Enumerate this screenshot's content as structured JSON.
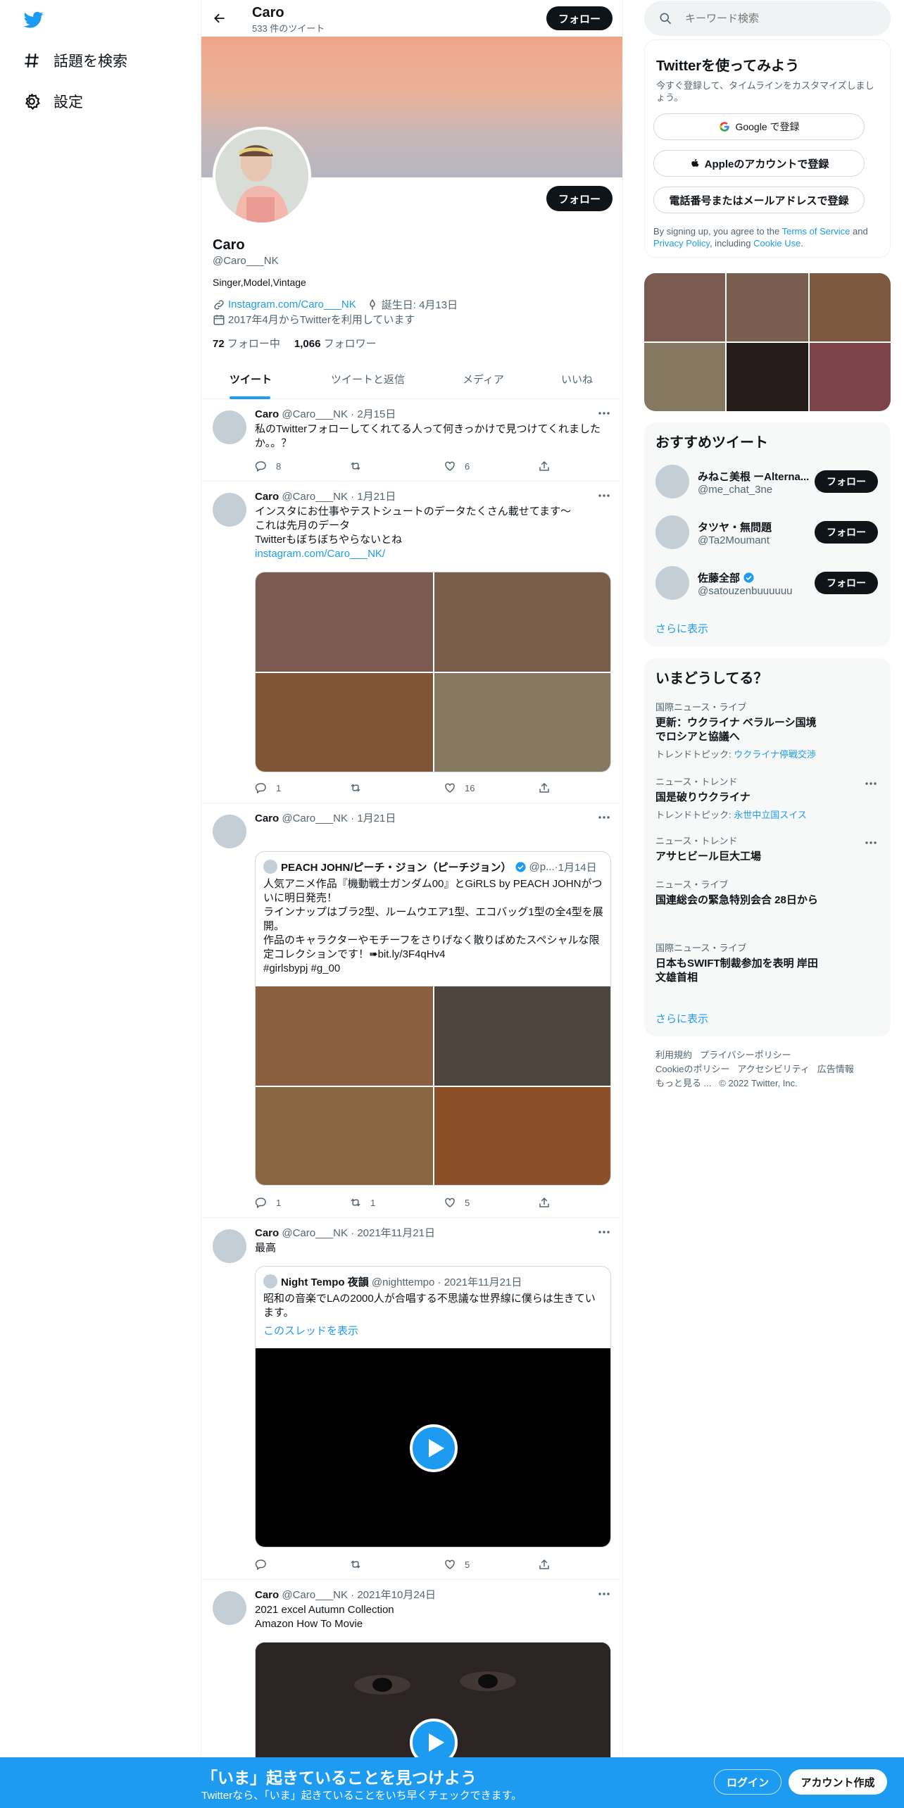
{
  "colors": {
    "accent": "#1d9bf0",
    "dark": "#0f1419",
    "muted": "#536471",
    "border": "#eff3f4",
    "verified": "#1d9bf0",
    "bar": "#1d9bf0"
  },
  "nav": {
    "explore": "話題を検索",
    "settings": "設定"
  },
  "header": {
    "name": "Caro",
    "tweet_count": "533 件のツイート",
    "follow": "フォロー"
  },
  "profile": {
    "follow": "フォロー",
    "name": "Caro",
    "handle": "@Caro___NK",
    "bio": "Singer,Model,Vintage",
    "link": "Instagram.com/Caro___NK",
    "birthday": "誕生日: 4月13日",
    "joined": "2017年4月からTwitterを利用しています",
    "following_count": "72",
    "following_label": "フォロー中",
    "followers_count": "1,066",
    "followers_label": "フォロワー"
  },
  "tabs": [
    "ツイート",
    "ツイートと返信",
    "メディア",
    "いいね"
  ],
  "tweets": [
    {
      "name": "Caro",
      "handle": "@Caro___NK",
      "date": "2月15日",
      "text": "私のTwitterフォローしてくれてる人って何きっかけで見つけてくれましたか。。？",
      "reply": "8",
      "retweet": "",
      "like": "6"
    },
    {
      "name": "Caro",
      "handle": "@Caro___NK",
      "date": "1月21日",
      "text1": "インスタにお仕事やテストシュートのデータたくさん載せてます〜",
      "text2": "これは先月のデータ",
      "text3": "Twitterもぼちぼちやらないとね",
      "link": "instagram.com/Caro___NK/",
      "reply": "1",
      "retweet": "",
      "like": "16",
      "media_colors": [
        "#7b5a4f",
        "#7a5e4b",
        "#7f5535",
        "#857962"
      ]
    },
    {
      "name": "Caro",
      "handle": "@Caro___NK",
      "date": "1月21日",
      "reply": "1",
      "retweet": "1",
      "like": "5",
      "quote": {
        "name": "PEACH JOHN/ピーチ・ジョン（ピーチジョン）",
        "handle": "@p...",
        "date": "1月14日",
        "text1": "人気アニメ作品『機動戦士ガンダム00』とGiRLS by PEACH JOHNがついに明日発売！",
        "text2": "ラインナップはブラ2型、ルームウエア1型、エコバッグ1型の全4型を展開。",
        "text3": "作品のキャラクターやモチーフをさりげなく散りばめたスペシャルな限定コレクションです！➠bit.ly/3F4qHv4",
        "text4": "#girlsbypj  #g_00"
      },
      "media_colors": [
        "#8b5e3f",
        "#4e463e",
        "#8a6640",
        "#8d4f28"
      ]
    },
    {
      "name": "Caro",
      "handle": "@Caro___NK",
      "date": "2021年11月21日",
      "text": "最高",
      "reply": "",
      "retweet": "",
      "like": "5",
      "quote": {
        "name": "Night Tempo 夜韻",
        "handle": "@nighttempo",
        "date": "2021年11月21日",
        "text": "昭和の音楽でLAの2000人が合唱する不思議な世界線に僕らは生きています。",
        "show_thread": "このスレッドを表示"
      }
    },
    {
      "name": "Caro",
      "handle": "@Caro___NK",
      "date": "2021年10月24日",
      "text1": "2021 excel Autumn Collection",
      "text2": "Amazon How To Movie"
    }
  ],
  "search": {
    "placeholder": "キーワード検索"
  },
  "signup": {
    "title": "Twitterを使ってみよう",
    "desc": "今すぐ登録して、タイムラインをカスタマイズしましょう。",
    "google": "Google で登録",
    "apple": "Appleのアカウントで登録",
    "phone": "電話番号またはメールアドレスで登録",
    "legal_prefix": "By signing up, you agree to the ",
    "terms": "Terms of Service",
    "and": " and ",
    "privacy": "Privacy Policy",
    "including": ", including ",
    "cookie": "Cookie Use",
    "end": "."
  },
  "media_grid_colors": [
    "#7b5a52",
    "#7a5e50",
    "#7d5a3f",
    "#857860",
    "#251b1a",
    "#7c4448"
  ],
  "recommended": {
    "title": "おすすめツイート",
    "more": "さらに表示",
    "follow": "フォロー",
    "users": [
      {
        "name": "みねこ美根 ーAlterna...",
        "handle": "@me_chat_3ne",
        "verified": false
      },
      {
        "name": "タツヤ・無問題",
        "handle": "@Ta2Moumant",
        "verified": false
      },
      {
        "name": "佐藤全部",
        "handle": "@satouzenbuuuuuu",
        "verified": true
      }
    ]
  },
  "trends": {
    "title": "いまどうしてる？",
    "more": "さらに表示",
    "items": [
      {
        "cat": "国際ニュース・ライブ",
        "title1": "更新：ウクライナ ベラルーシ国境",
        "title2": "でロシアと協議へ",
        "sub_prefix": "トレンドトピック: ",
        "sub_link": "ウクライナ停戦交渉"
      },
      {
        "cat": "ニュース・トレンド",
        "title1": "国是破りウクライナ",
        "sub_prefix": "トレンドトピック: ",
        "sub_link": "永世中立国スイス"
      },
      {
        "cat": "ニュース・トレンド",
        "title1": "アサヒビール巨大工場"
      },
      {
        "cat": "ニュース・ライブ",
        "title1": "国連総会の緊急特別会合 28日から"
      },
      {
        "cat": "国際ニュース・ライブ",
        "title1": "日本もSWIFT制裁参加を表明 岸田",
        "title2": "文雄首相"
      }
    ]
  },
  "footer": {
    "terms": "利用規約",
    "privacy": "プライバシーポリシー",
    "cookie": "Cookieのポリシー",
    "access": "アクセシビリティ",
    "ads": "広告情報",
    "more": "もっと見る ...",
    "copyright": "© 2022 Twitter, Inc."
  },
  "bottom": {
    "title": "「いま」起きていることを見つけよう",
    "sub": "Twitterなら、「いま」起きていることをいち早くチェックできます。",
    "login": "ログイン",
    "signup": "アカウント作成"
  }
}
